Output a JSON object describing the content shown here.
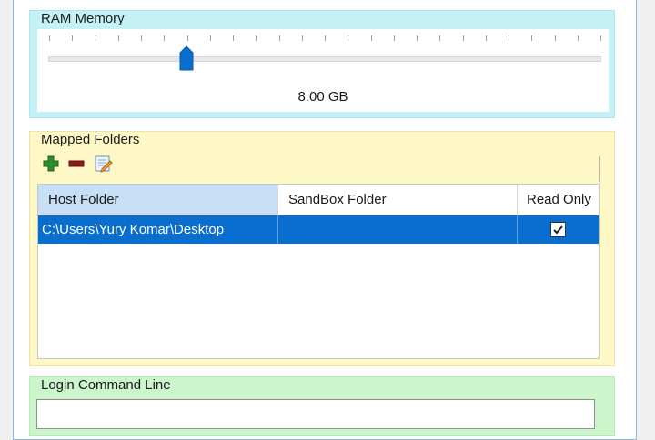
{
  "ram": {
    "legend": "RAM Memory",
    "value_label": "8.00 GB",
    "tick_count": 25,
    "slider_fraction": 0.25
  },
  "mapped_folders": {
    "legend": "Mapped Folders",
    "toolbar": [
      {
        "name": "add-folder-button",
        "icon": "plus-icon",
        "color": "#2e8b2e"
      },
      {
        "name": "remove-folder-button",
        "icon": "minus-icon",
        "color": "#8b1a1a"
      },
      {
        "name": "edit-folder-button",
        "icon": "edit-icon"
      }
    ],
    "columns": {
      "host": "Host Folder",
      "sandbox": "SandBox Folder",
      "readonly": "Read Only"
    },
    "rows": [
      {
        "host": "C:\\Users\\Yury Komar\\Desktop",
        "sandbox": "",
        "read_only": true
      }
    ]
  },
  "login": {
    "legend": "Login Command Line",
    "value": ""
  },
  "colors": {
    "ram_group": "#c3f1f6",
    "mapped_group": "#fdf8c6",
    "login_group": "#cdf5cc",
    "selection": "#0a6ecf",
    "slider_thumb": "#0a6ecf"
  }
}
